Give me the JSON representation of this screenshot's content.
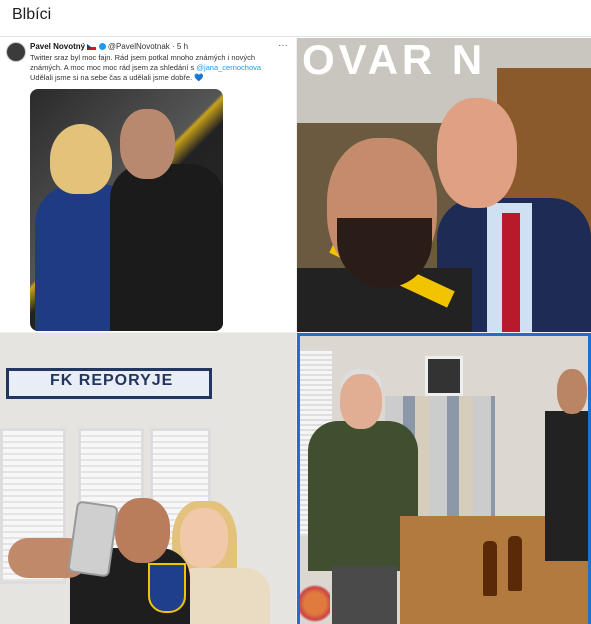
{
  "header": {
    "title": "Blbíci"
  },
  "tweet": {
    "author_name": "Pavel Novotný",
    "author_handle": "@PavelNovotnak",
    "time": "5 h",
    "more_label": "···",
    "text_line1": "Twitter sraz byl moc fajn. Rád jsem potkal mnoho známých i nových",
    "text_line2": "známých. A moc moc moc rád jsem za shledání s",
    "mention": "@jana_cernochova",
    "text_line3": "Udělali jsme si na sebe čas a udělali jsme dobře. 💙"
  },
  "photo2": {
    "sign_text": "OVAR N"
  },
  "photo3": {
    "scarf_text": "FK REPORYJE"
  },
  "colors": {
    "selection_border": "#1f6fd1",
    "twitter_blue": "#1d9bf0"
  }
}
